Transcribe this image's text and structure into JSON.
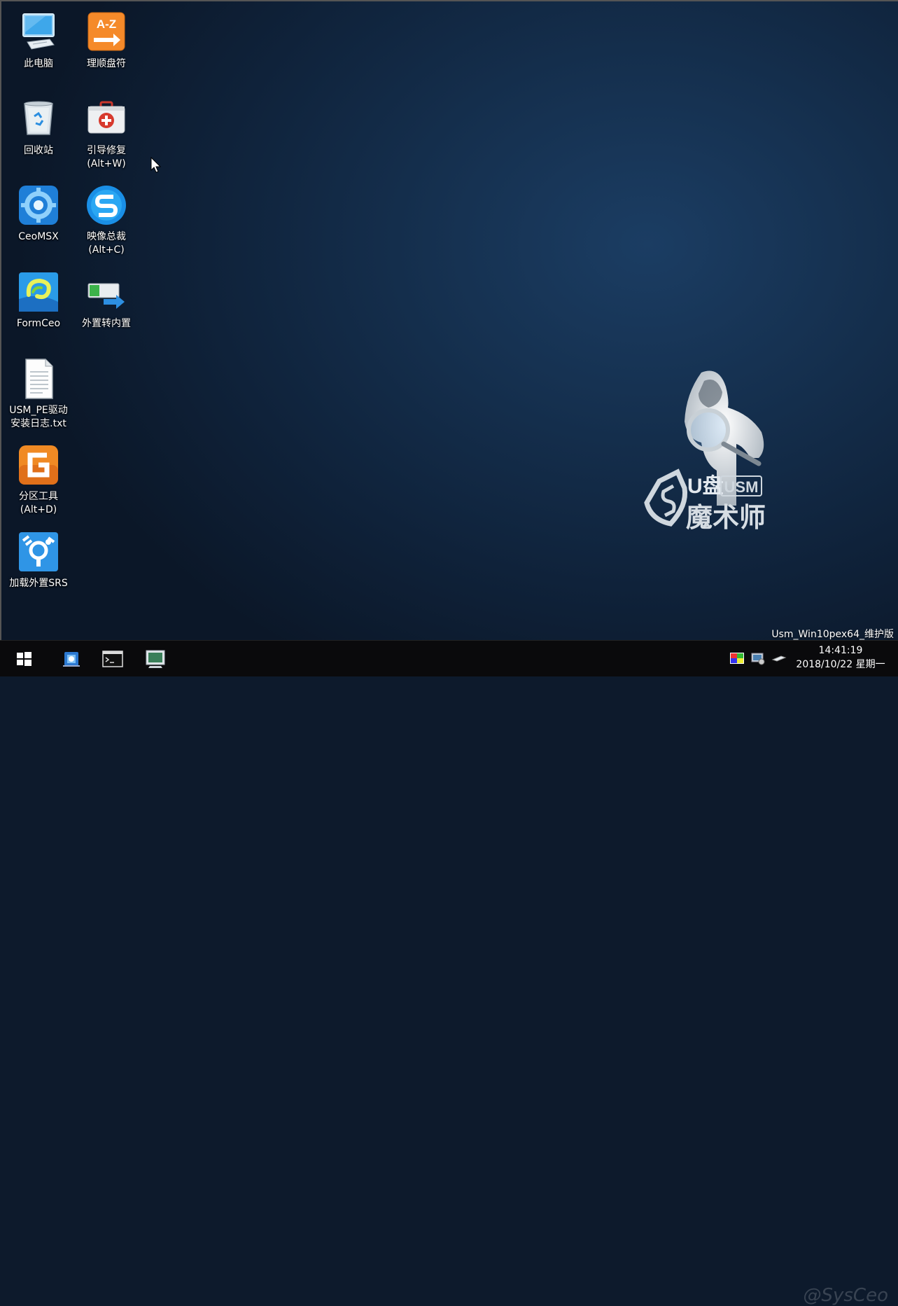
{
  "desktop": {
    "icons": [
      {
        "name": "this-pc",
        "label": "此电脑"
      },
      {
        "name": "drive-letter-sort",
        "label": "理顺盘符"
      },
      {
        "name": "recycle-bin",
        "label": "回收站"
      },
      {
        "name": "boot-repair",
        "label": "引导修复\n(Alt+W)"
      },
      {
        "name": "ceomsx",
        "label": "CeoMSX"
      },
      {
        "name": "image-manager",
        "label": "映像总裁\n(Alt+C)"
      },
      {
        "name": "formceo",
        "label": "FormCeo"
      },
      {
        "name": "external-to-internal",
        "label": "外置转内置"
      },
      {
        "name": "driver-log",
        "label": "USM_PE驱动\n安装日志.txt"
      },
      {
        "name": "partition-tool",
        "label": "分区工具\n(Alt+D)"
      },
      {
        "name": "load-external-srs",
        "label": "加载外置SRS"
      }
    ],
    "wallpaper": {
      "logo_line1": "U盘",
      "logo_badge": "USM",
      "logo_line2": "魔术师"
    },
    "edition": "Usm_Win10pex64_维护版"
  },
  "taskbar": {
    "clock_time": "14:41:19",
    "clock_date": "2018/10/22 星期一"
  },
  "watermark": "@SysCeo",
  "colors": {
    "taskbar": "#0a0a0c",
    "accent_blue": "#2a8fe0",
    "orange": "#f08a24"
  }
}
